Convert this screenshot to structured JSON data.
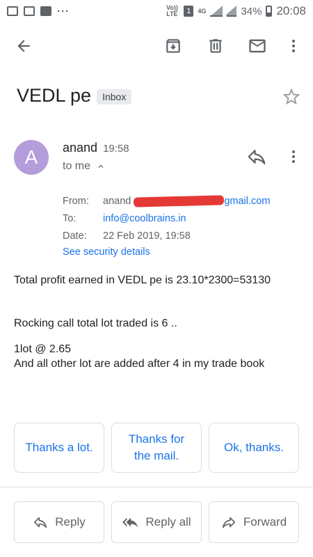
{
  "status": {
    "volte": "Vo)) LTE",
    "sim": "1",
    "net": "4G",
    "battery": "34%",
    "time": "20:08"
  },
  "toolbar": {
    "icons": [
      "back-arrow-icon",
      "archive-icon",
      "trash-icon",
      "mark-unread-icon",
      "more-vert-icon"
    ]
  },
  "email": {
    "subject": "VEDL pe",
    "label": "Inbox",
    "sender_initial": "A",
    "sender_name": "anand",
    "sender_time": "19:58",
    "to_me": "to me",
    "details": {
      "from_label": "From:",
      "from_name": "anand",
      "from_domain": "gmail.com",
      "to_label": "To:",
      "to_value": "info@coolbrains.in",
      "date_label": "Date:",
      "date_value": "22 Feb 2019, 19:58",
      "security_link": "See security details"
    },
    "body": {
      "line1": "Total profit earned in VEDL pe is 23.10*2300=53130",
      "line2": "Rocking call total lot traded is 6 ..",
      "line3": "1lot @ 2.65",
      "line4": "And all other lot are added after 4 in my trade book"
    }
  },
  "smart_replies": [
    "Thanks a lot.",
    "Thanks for the mail.",
    "Ok, thanks."
  ],
  "actions": {
    "reply": "Reply",
    "reply_all": "Reply all",
    "forward": "Forward"
  },
  "colors": {
    "accent": "#1a73e8",
    "avatar": "#b39ddb",
    "redaction": "#e53935"
  }
}
